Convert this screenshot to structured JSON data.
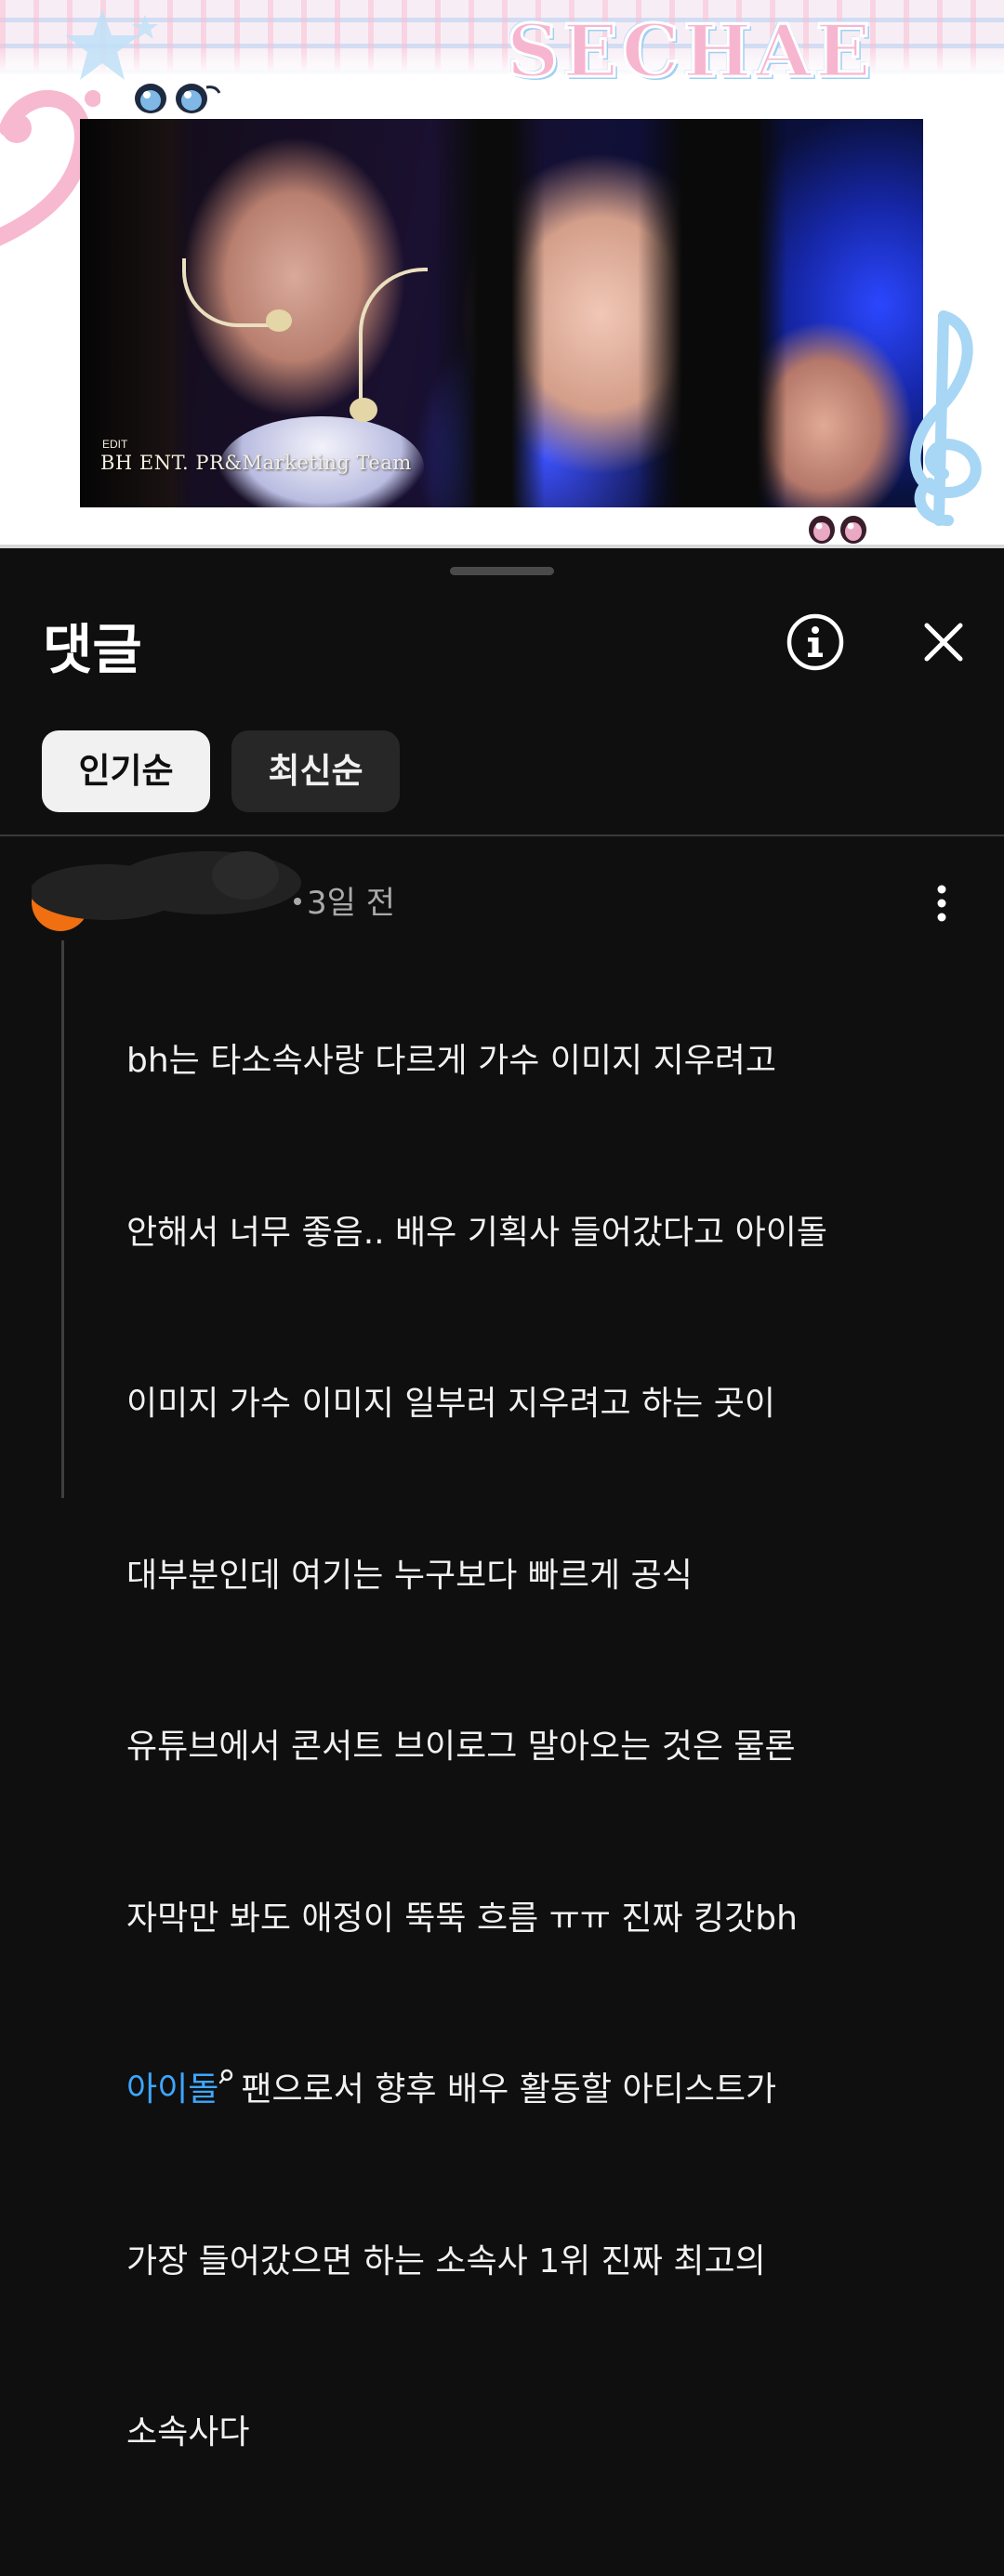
{
  "video": {
    "logo_text": "SECHAE",
    "watermark_small": "EDIT",
    "watermark": "BH ENT. PR&Marketing Team"
  },
  "comments_panel": {
    "title": "댓글",
    "icons": {
      "info": "info-icon",
      "close": "close-icon",
      "more": "more-vert-icon"
    },
    "sort_chips": [
      {
        "label": "인기순",
        "selected": true
      },
      {
        "label": "최신순",
        "selected": false
      }
    ],
    "comment": {
      "time": "3일 전",
      "lines": [
        "bh는 타소속사랑 다르게 가수 이미지 지우려고",
        "안해서 너무 좋음.. 배우 기획사 들어갔다고 아이돌",
        "이미지 가수 이미지 일부러 지우려고 하는 곳이",
        "대부분인데 여기는 누구보다 빠르게 공식",
        "유튜브에서 콘서트 브이로그 말아오는 것은 물론",
        "자막만 봐도 애정이 뚝뚝 흐름 ㅠㅠ 진짜 킹갓bh"
      ],
      "link_text": "아이돌",
      "line7_rest": "팬으로서 향후 배우 활동할 아티스트가",
      "lines_after": [
        "가장 들어갔으면 하는 소속사 1위 진짜 최고의",
        "소속사다"
      ]
    }
  },
  "colors": {
    "panel_bg": "#0f0f0f",
    "chip_active_bg": "#f1f1f1",
    "chip_inactive_bg": "#272727",
    "link": "#3ea6ff",
    "avatar": "#f06f10",
    "meta_text": "#aaaaaa"
  }
}
